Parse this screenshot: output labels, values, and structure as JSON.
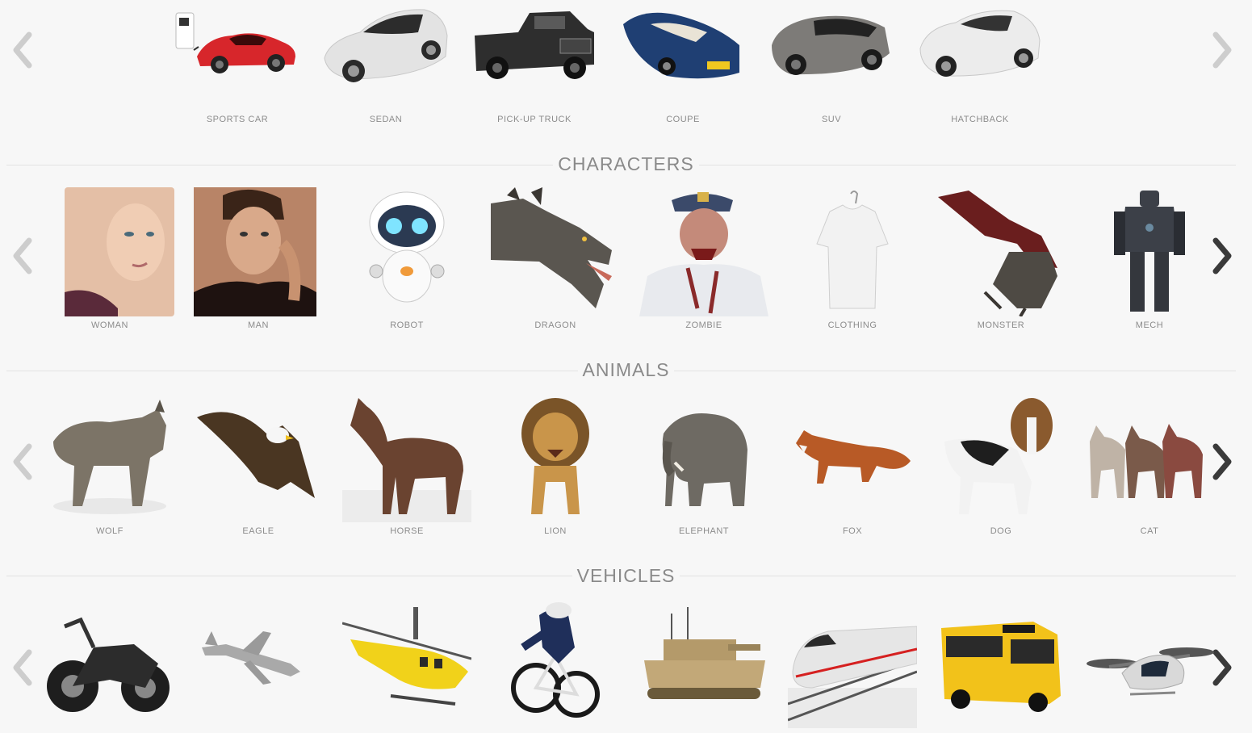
{
  "rows": {
    "cars": {
      "items": [
        {
          "label": "SPORTS CAR",
          "icon": "sports-car-icon",
          "color": "#d7262b"
        },
        {
          "label": "SEDAN",
          "icon": "sedan-icon",
          "color": "#e3e3e3"
        },
        {
          "label": "PICK-UP TRUCK",
          "icon": "pickup-truck-icon",
          "color": "#2e2e2e"
        },
        {
          "label": "COUPE",
          "icon": "coupe-icon",
          "color": "#1f3f73"
        },
        {
          "label": "SUV",
          "icon": "suv-icon",
          "color": "#7d7b78"
        },
        {
          "label": "HATCHBACK",
          "icon": "hatchback-icon",
          "color": "#ececec"
        }
      ]
    },
    "characters": {
      "title": "CHARACTERS",
      "items": [
        {
          "label": "WOMAN",
          "icon": "woman-icon",
          "color": "#e4bfa6"
        },
        {
          "label": "MAN",
          "icon": "man-icon",
          "color": "#b88467"
        },
        {
          "label": "ROBOT",
          "icon": "robot-icon",
          "color": "#ffffff"
        },
        {
          "label": "DRAGON",
          "icon": "dragon-icon",
          "color": "#5a5650"
        },
        {
          "label": "ZOMBIE",
          "icon": "zombie-icon",
          "color": "#3b4a6a"
        },
        {
          "label": "CLOTHING",
          "icon": "tshirt-icon",
          "color": "#f2f2f2"
        },
        {
          "label": "MONSTER",
          "icon": "winged-monster-icon",
          "color": "#6a1e1e"
        },
        {
          "label": "MECH",
          "icon": "mech-icon",
          "color": "#3c4048"
        }
      ]
    },
    "animals": {
      "title": "ANIMALS",
      "items": [
        {
          "label": "WOLF",
          "icon": "wolf-icon",
          "color": "#7c7467"
        },
        {
          "label": "EAGLE",
          "icon": "eagle-icon",
          "color": "#4a3622"
        },
        {
          "label": "HORSE",
          "icon": "horse-icon",
          "color": "#6a4330"
        },
        {
          "label": "LION",
          "icon": "lion-icon",
          "color": "#c9954a"
        },
        {
          "label": "ELEPHANT",
          "icon": "elephant-icon",
          "color": "#6e6a63"
        },
        {
          "label": "FOX",
          "icon": "fox-icon",
          "color": "#b85a26"
        },
        {
          "label": "DOG",
          "icon": "dog-icon",
          "color": "#8a5a2e"
        },
        {
          "label": "CAT",
          "icon": "cat-icon",
          "color": "#7a5a4a"
        }
      ]
    },
    "vehicles": {
      "title": "VEHICLES",
      "items": [
        {
          "label": "",
          "icon": "motorcycle-icon",
          "color": "#1e1e1e"
        },
        {
          "label": "",
          "icon": "airplane-icon",
          "color": "#a9a9a9"
        },
        {
          "label": "",
          "icon": "helicopter-icon",
          "color": "#f1d21a"
        },
        {
          "label": "",
          "icon": "cyclist-icon",
          "color": "#1f2f5a"
        },
        {
          "label": "",
          "icon": "tank-icon",
          "color": "#b49a6a"
        },
        {
          "label": "",
          "icon": "train-icon",
          "color": "#e6e6e6"
        },
        {
          "label": "",
          "icon": "school-bus-icon",
          "color": "#f2c21a"
        },
        {
          "label": "",
          "icon": "flying-taxi-icon",
          "color": "#d9d9d9"
        }
      ]
    }
  }
}
